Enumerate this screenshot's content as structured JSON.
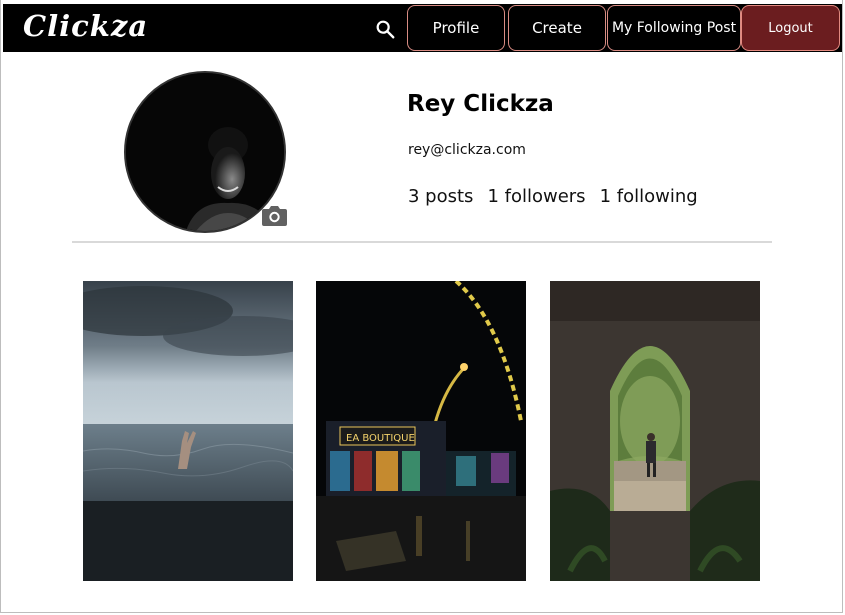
{
  "nav": {
    "brand": "Clickza",
    "profile_label": "Profile",
    "create_label": "Create",
    "following_label": "My Following Post",
    "logout_label": "Logout"
  },
  "profile": {
    "name": "Rey Clickza",
    "email": "rey@clickza.com",
    "posts": "3 posts",
    "followers": "1 followers",
    "following": "1 following"
  },
  "posts": [
    {
      "description": "hand-in-sea-photo"
    },
    {
      "description": "night-street-lights-photo"
    },
    {
      "description": "stone-arch-forest-photo"
    }
  ],
  "colors": {
    "nav_bg": "#000000",
    "button_border": "#d98c84",
    "logout_bg": "#6b1d1f"
  }
}
